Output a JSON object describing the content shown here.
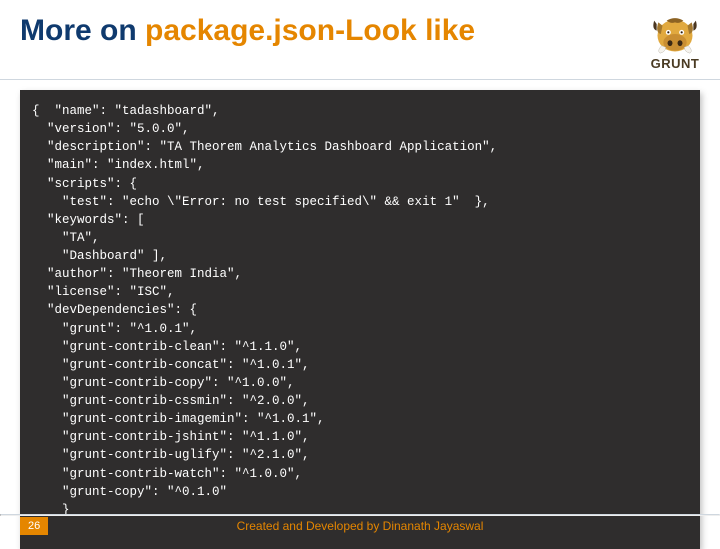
{
  "title": {
    "part1": "More on ",
    "part2": "package.json-Look like"
  },
  "logo_label": "GRUNT",
  "code_lines": [
    "{  \"name\": \"tadashboard\",",
    "  \"version\": \"5.0.0\",",
    "  \"description\": \"TA Theorem Analytics Dashboard Application\",",
    "  \"main\": \"index.html\",",
    "  \"scripts\": {",
    "    \"test\": \"echo \\\"Error: no test specified\\\" && exit 1\"  },",
    "  \"keywords\": [",
    "    \"TA\",",
    "    \"Dashboard\" ],",
    "  \"author\": \"Theorem India\",",
    "  \"license\": \"ISC\",",
    "  \"devDependencies\": {",
    "    \"grunt\": \"^1.0.1\",",
    "    \"grunt-contrib-clean\": \"^1.1.0\",",
    "    \"grunt-contrib-concat\": \"^1.0.1\",",
    "    \"grunt-contrib-copy\": \"^1.0.0\",",
    "    \"grunt-contrib-cssmin\": \"^2.0.0\",",
    "    \"grunt-contrib-imagemin\": \"^1.0.1\",",
    "    \"grunt-contrib-jshint\": \"^1.1.0\",",
    "    \"grunt-contrib-uglify\": \"^2.1.0\",",
    "    \"grunt-contrib-watch\": \"^1.0.0\",",
    "    \"grunt-copy\": \"^0.1.0\"",
    "    }",
    "}"
  ],
  "footer": {
    "page": "26",
    "credit": "Created and Developed by Dinanath Jayaswal"
  }
}
